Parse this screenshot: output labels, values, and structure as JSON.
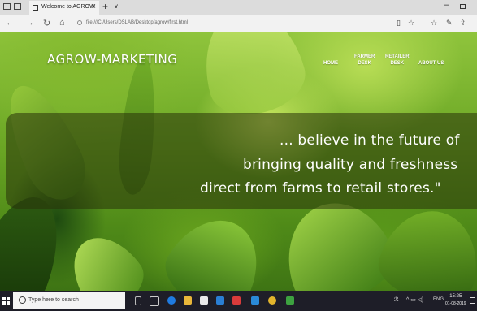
{
  "browser": {
    "tab_title": "Welcome to AGROW",
    "tab_close": "×",
    "new_tab": "+",
    "tab_menu": "∨",
    "url": "file:///C:/Users/DSLAB/Desktop/agrow/first.html",
    "nav": {
      "back": "←",
      "forward": "→",
      "refresh": "↻",
      "home": "⌂"
    },
    "tools": {
      "reading": "▯",
      "favorite": "☆",
      "favorites_hub": "☆",
      "notes": "✎",
      "share": "⇪"
    },
    "window_minimize": "–"
  },
  "page": {
    "brand": "AGROW-MARKETING",
    "menu": [
      {
        "label": "HOME"
      },
      {
        "line1": "FARMER",
        "line2": "DESK"
      },
      {
        "line1": "RETAILER",
        "line2": "DESK"
      },
      {
        "label": "ABOUT US"
      }
    ],
    "quote": {
      "line1": "... believe in the future of",
      "line2": "bringing quality and freshness",
      "line3": "direct from farms to retail stores.\""
    }
  },
  "taskbar": {
    "search_placeholder": "Type here to search",
    "tray": {
      "people": "ℛ",
      "icons": "^ ▭ ◁)",
      "lang": "ENG"
    },
    "time": "15:25",
    "date": "01-08-2019"
  },
  "colors": {
    "taskbar": "#1e1e28",
    "browser_chrome": "#f2f2f2",
    "leaf_green": "#7bb82a",
    "overlay": "rgba(40,50,10,0.55)"
  }
}
